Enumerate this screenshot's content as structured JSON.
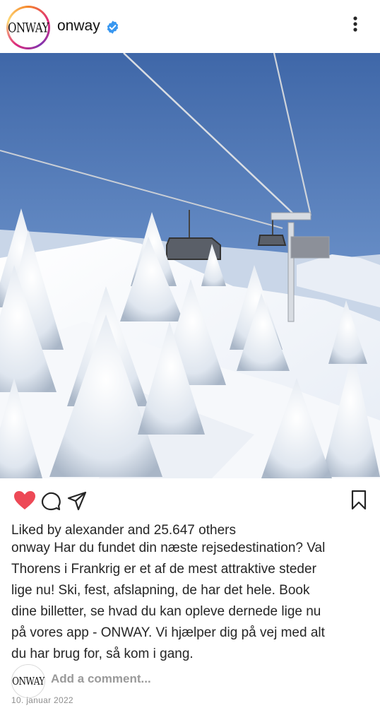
{
  "header": {
    "logo_text": "ONWAY",
    "username": "onway",
    "verified_icon": "verified-badge-icon",
    "more_icon": "more-options-icon"
  },
  "post": {
    "image_alt": "Ski lift over snowy mountain with frosted pine trees",
    "liked_prefix": "Liked by ",
    "liked_user": "alexander",
    "liked_and": " and ",
    "liked_count": "25.647 others",
    "caption_user": "onway",
    "caption_lines": [
      "Har du fundet din næste rejsedestination? Val",
      "Thorens i Frankrig er et af de mest attraktive steder",
      "lige nu! Ski, fest, afslapning, de har det hele. Book",
      "dine billetter, se hvad du kan opleve dernede lige nu",
      "på vores app - ONWAY. Vi hjælper dig på vej med alt",
      "du har brug for, så kom i gang."
    ],
    "add_comment_placeholder": "Add a comment...",
    "date": "10. januar 2022"
  },
  "colors": {
    "heart": "#ed4956",
    "verified": "#3897f0",
    "sky": "#4a74b3"
  }
}
